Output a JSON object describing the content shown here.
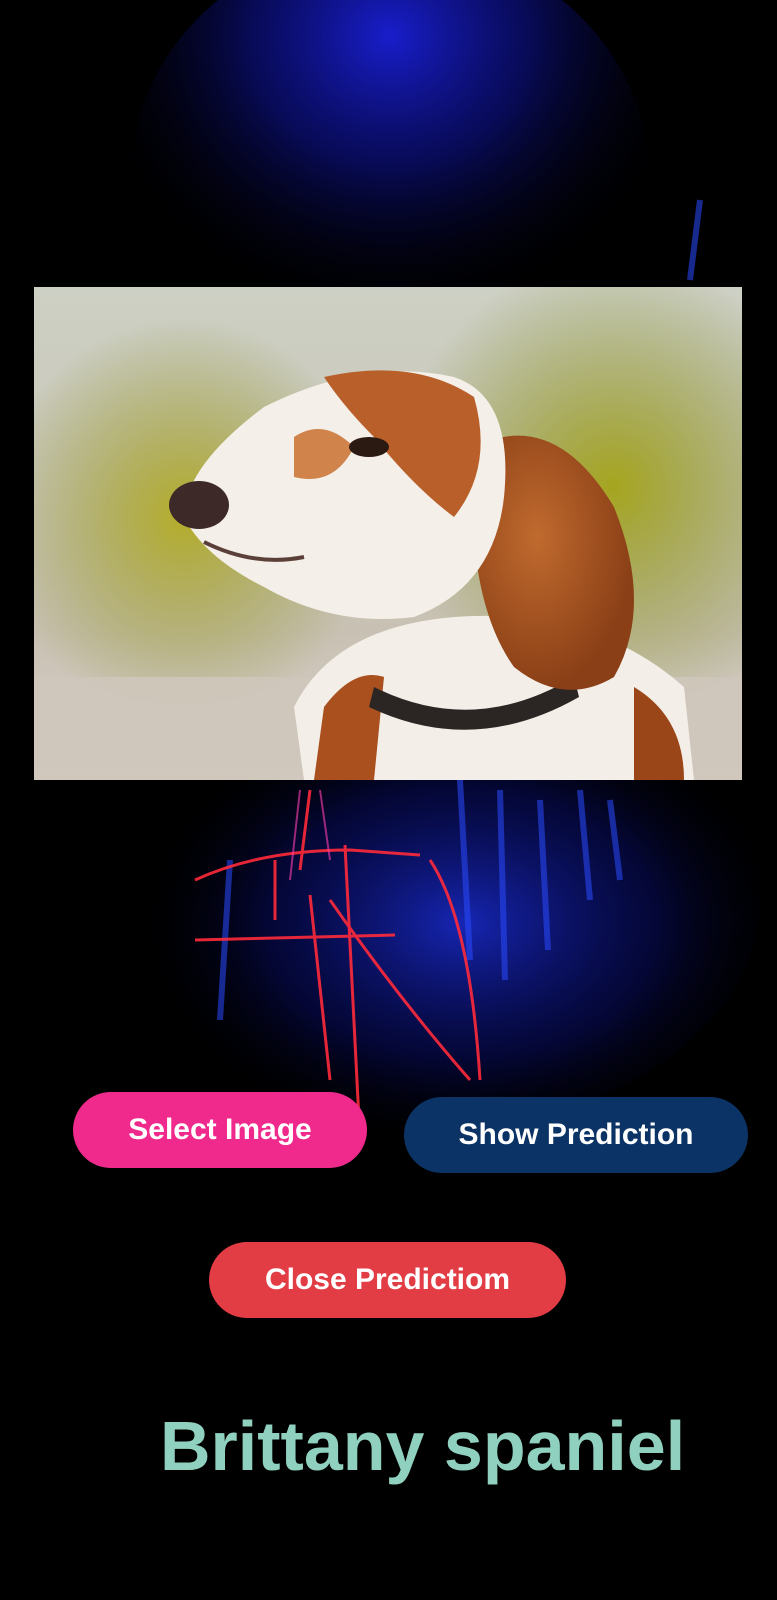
{
  "buttons": {
    "select_image": "Select Image",
    "show_prediction": "Show Prediction",
    "close_prediction": "Close Predictiom"
  },
  "prediction": {
    "label": "Brittany spaniel"
  },
  "colors": {
    "background": "#000000",
    "select_button": "#F02A8C",
    "show_button": "#0B3366",
    "close_button": "#E23C45",
    "prediction_text": "#8FD1BE"
  }
}
